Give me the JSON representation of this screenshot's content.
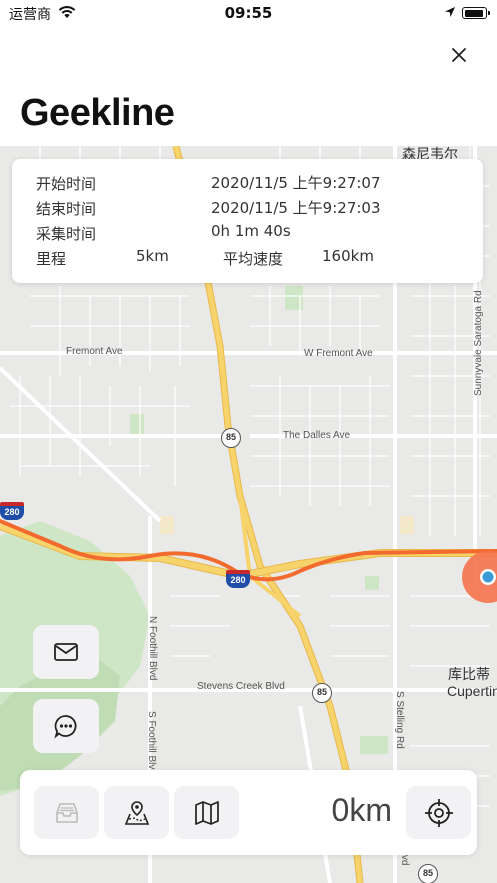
{
  "status_bar": {
    "carrier": "运营商",
    "time": "09:55",
    "icons": [
      "wifi-icon",
      "location-arrow-icon",
      "battery-icon"
    ]
  },
  "header": {
    "title": "Geekline",
    "close_icon": "close-icon"
  },
  "track_info": {
    "start_label": "开始时间",
    "start_value": "2020/11/5 上午9:27:07",
    "end_label": "结束时间",
    "end_value": "2020/11/5 上午9:27:03",
    "duration_label": "采集时间",
    "duration_value": "0h 1m 40s",
    "distance_label": "里程",
    "distance_value": "5km",
    "speed_label": "平均速度",
    "speed_value": "160km"
  },
  "map": {
    "labels": {
      "fremont_ave": "Fremont Ave",
      "w_fremont_ave": "W Fremont Ave",
      "dalles_ave": "The Dalles Ave",
      "stevens_creek": "Stevens Creek Blvd",
      "foothill_n": "N Foothill Blvd",
      "foothill_s": "S Foothill Blvd",
      "stelling": "S Stelling Rd",
      "de_anza": "S De Anza Blvd",
      "sunnyvale_saratoga": "Sunnyvale Saratoga Rd",
      "sunnyvale_cn": "森尼韦尔",
      "cupertino_cn": "库比蒂",
      "cupertino_en": "Cupertin"
    },
    "shields": {
      "sr85_north": "85",
      "sr85_south": "85",
      "sr85_bottom": "85",
      "i280_left": "280",
      "i280_center": "280"
    },
    "route_color": "#f26a2e",
    "highway_color": "#f7d36b"
  },
  "side_buttons": {
    "mail_icon": "mail-icon",
    "chat_icon": "chat-bubble-icon"
  },
  "toolbar": {
    "archive_icon": "archive-tray-icon",
    "route_map_icon": "map-pin-route-icon",
    "map_icon": "folded-map-icon",
    "distance": "0km",
    "locate_icon": "crosshair-locate-icon"
  }
}
